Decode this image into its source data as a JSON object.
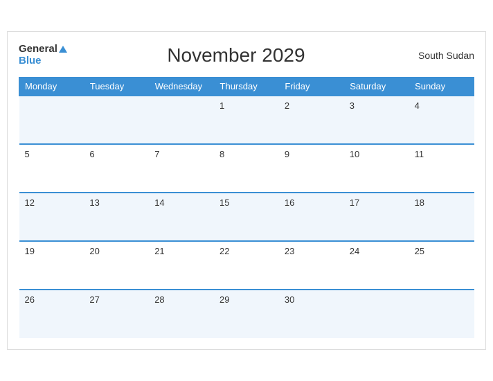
{
  "header": {
    "logo_general": "General",
    "logo_blue": "Blue",
    "title": "November 2029",
    "region": "South Sudan"
  },
  "weekdays": [
    "Monday",
    "Tuesday",
    "Wednesday",
    "Thursday",
    "Friday",
    "Saturday",
    "Sunday"
  ],
  "weeks": [
    [
      "",
      "",
      "",
      "1",
      "2",
      "3",
      "4"
    ],
    [
      "5",
      "6",
      "7",
      "8",
      "9",
      "10",
      "11"
    ],
    [
      "12",
      "13",
      "14",
      "15",
      "16",
      "17",
      "18"
    ],
    [
      "19",
      "20",
      "21",
      "22",
      "23",
      "24",
      "25"
    ],
    [
      "26",
      "27",
      "28",
      "29",
      "30",
      "",
      ""
    ]
  ]
}
